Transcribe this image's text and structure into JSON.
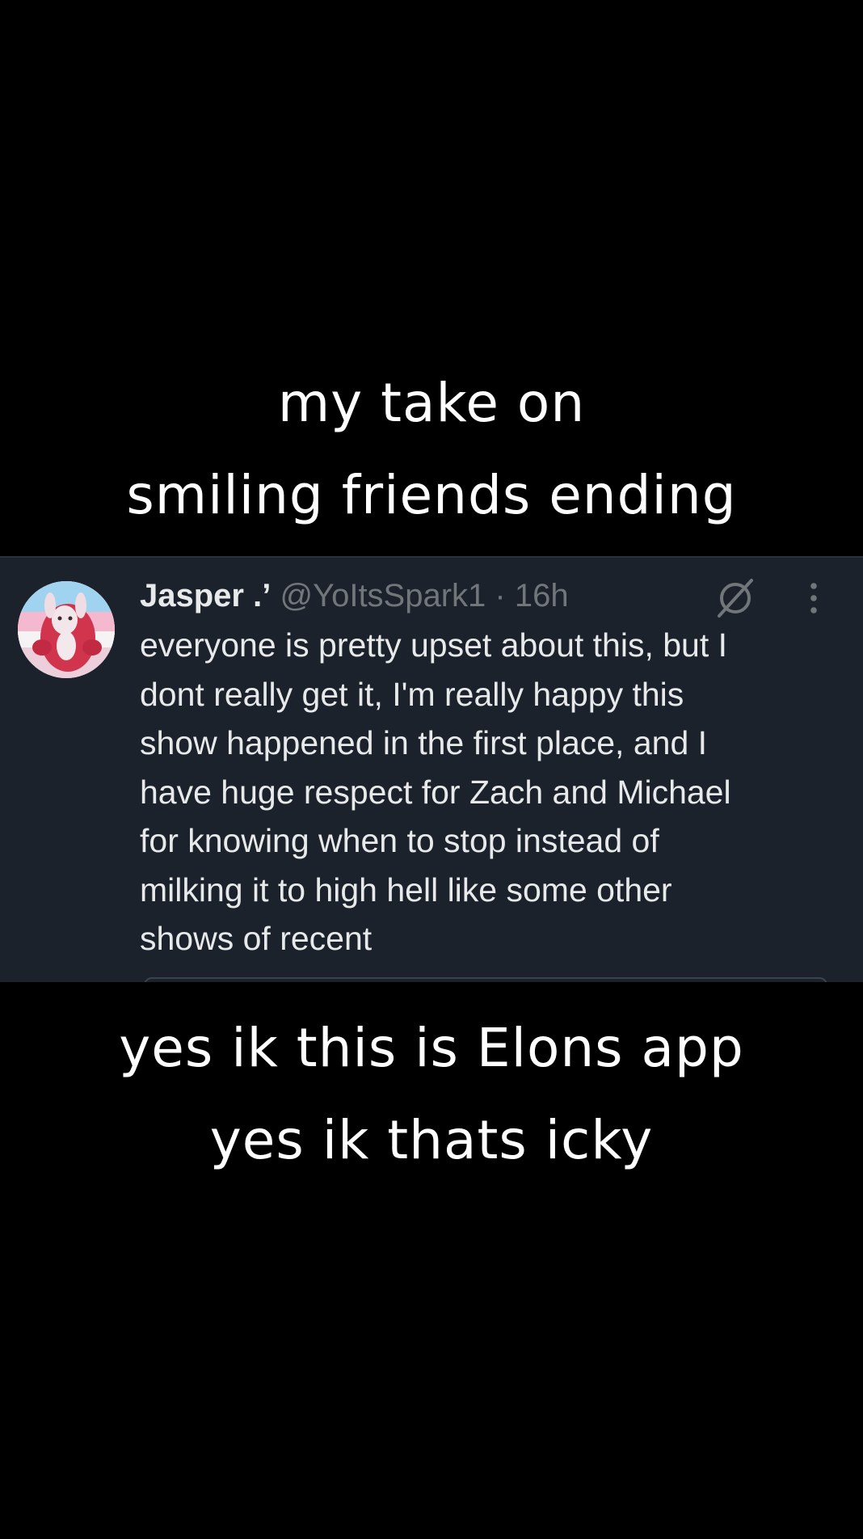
{
  "captions": {
    "top_line_1": "my take on",
    "top_line_2": "smiling friends ending",
    "bottom_line_1": "yes ik this is Elons app",
    "bottom_line_2": "yes ik thats icky"
  },
  "tweet": {
    "display_name": "Jasper",
    "name_badge": ".’",
    "handle": "@YoItsSpark1",
    "separator": "·",
    "time": "16h",
    "body_lines": [
      "everyone is pretty upset about this, but I",
      "dont really get it, I'm really happy this",
      "show happened in the first place, and I",
      "have huge respect for Zach and Michael",
      "for knowing when to stop instead of",
      "milking it to high hell like some other",
      "shows of recent"
    ],
    "icons": {
      "grok": "grok-slash-circle-icon",
      "more": "more-vertical-icon",
      "avatar": "avatar-image"
    }
  },
  "colors": {
    "background": "#000000",
    "card_background": "#1b222b",
    "primary_text": "#e7e9ea",
    "secondary_text": "#71767b",
    "caption_text": "#ffffff"
  }
}
